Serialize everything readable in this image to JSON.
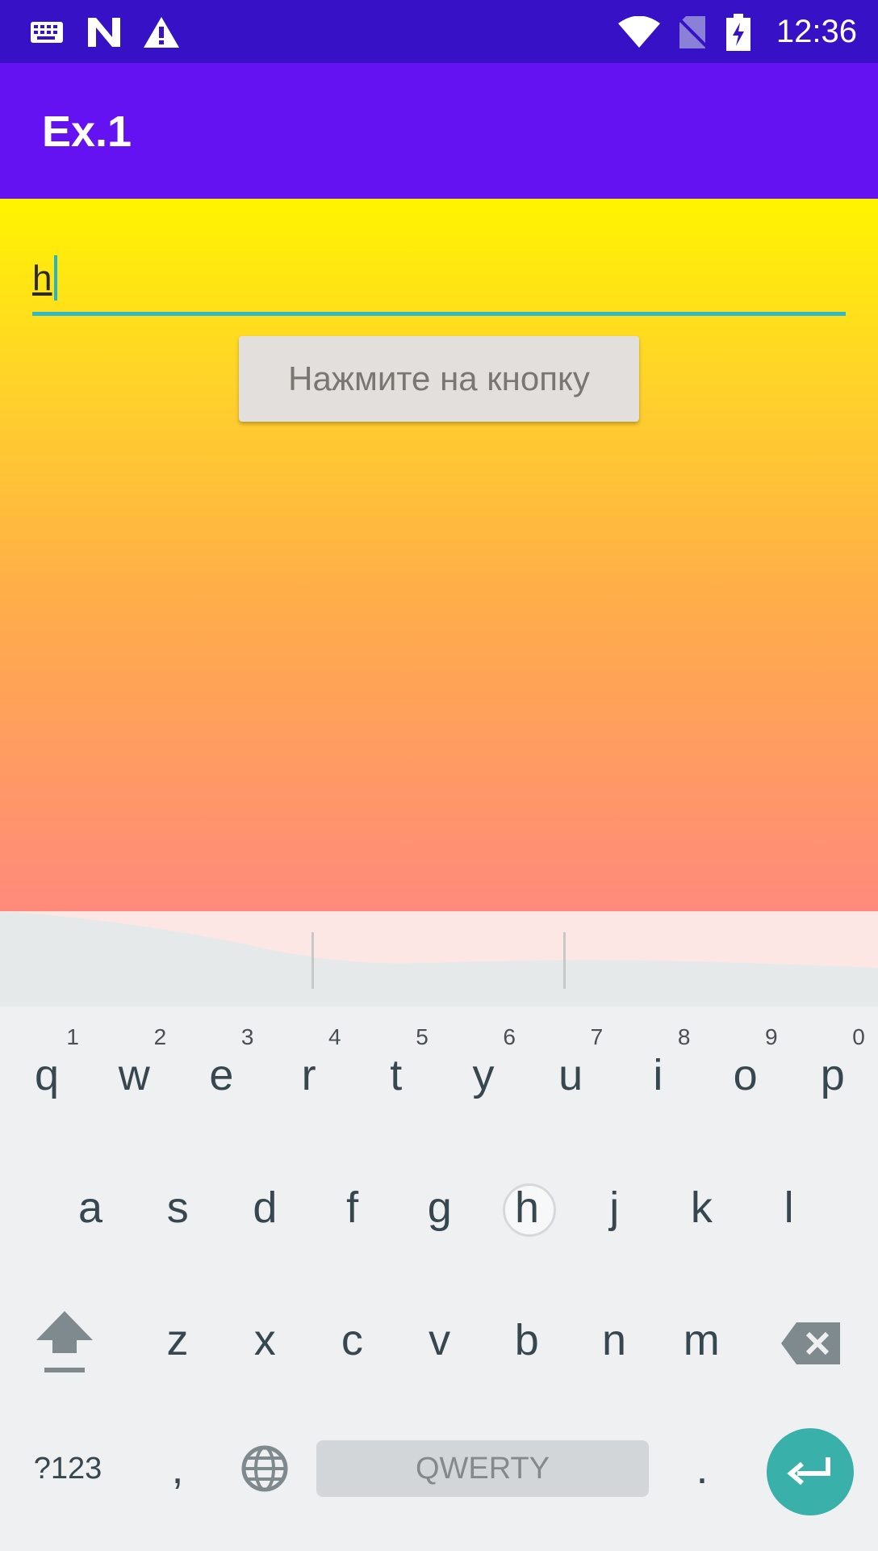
{
  "status_bar": {
    "time": "12:36",
    "icons": [
      "keyboard-icon",
      "n-logo-icon",
      "warning-icon",
      "wifi-icon",
      "no-sim-icon",
      "battery-charging-icon"
    ]
  },
  "app_bar": {
    "title": "Ex.1"
  },
  "form": {
    "input_value": "h",
    "button_label": "Нажмите на кнопку"
  },
  "keyboard": {
    "row1": [
      {
        "label": "q",
        "hint": "1"
      },
      {
        "label": "w",
        "hint": "2"
      },
      {
        "label": "e",
        "hint": "3"
      },
      {
        "label": "r",
        "hint": "4"
      },
      {
        "label": "t",
        "hint": "5"
      },
      {
        "label": "y",
        "hint": "6"
      },
      {
        "label": "u",
        "hint": "7"
      },
      {
        "label": "i",
        "hint": "8"
      },
      {
        "label": "o",
        "hint": "9"
      },
      {
        "label": "p",
        "hint": "0"
      }
    ],
    "row2": [
      "a",
      "s",
      "d",
      "f",
      "g",
      "h",
      "j",
      "k",
      "l"
    ],
    "row3": [
      "z",
      "x",
      "c",
      "v",
      "b",
      "n",
      "m"
    ],
    "symbols_label": "?123",
    "comma_label": ",",
    "space_label": "QWERTY",
    "period_label": ".",
    "pressed_key": "h",
    "colors": {
      "enter": "#3ab0aa",
      "accent": "#2fb8c8"
    }
  }
}
